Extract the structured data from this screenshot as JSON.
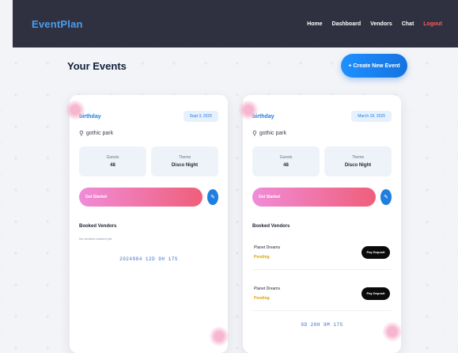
{
  "nav": {
    "logo": "EventPlan",
    "links": [
      "Home",
      "Dashboard",
      "Vendors",
      "Chat"
    ],
    "logout": "Logout"
  },
  "page": {
    "title": "Your Events",
    "create_button": "+ Create New Event"
  },
  "events": [
    {
      "name": "birthday",
      "date": "Sept 3, 2025",
      "location": "gothic park",
      "stats": [
        {
          "label": "Guests",
          "value": "48"
        },
        {
          "label": "Theme",
          "value": "Disco Night"
        }
      ],
      "progress_label": "Get Started",
      "vendors_title": "Booked Vendors",
      "empty_note": "No vendors booked yet.",
      "footer": "2024984 12D 9H 17S"
    },
    {
      "name": "birthday",
      "date": "March 18, 2025",
      "location": "gothic park",
      "stats": [
        {
          "label": "Guests",
          "value": "48"
        },
        {
          "label": "Theme",
          "value": "Disco Night"
        }
      ],
      "progress_label": "Get Started",
      "vendors_title": "Booked Vendors",
      "vendors": [
        {
          "name": "Planet Dreams",
          "status": "Pending",
          "button": "Pay Deposit"
        },
        {
          "name": "Planet Dreams",
          "status": "Pending",
          "button": "Pay Deposit"
        }
      ],
      "footer": "9D 20H 9M 17S"
    }
  ]
}
